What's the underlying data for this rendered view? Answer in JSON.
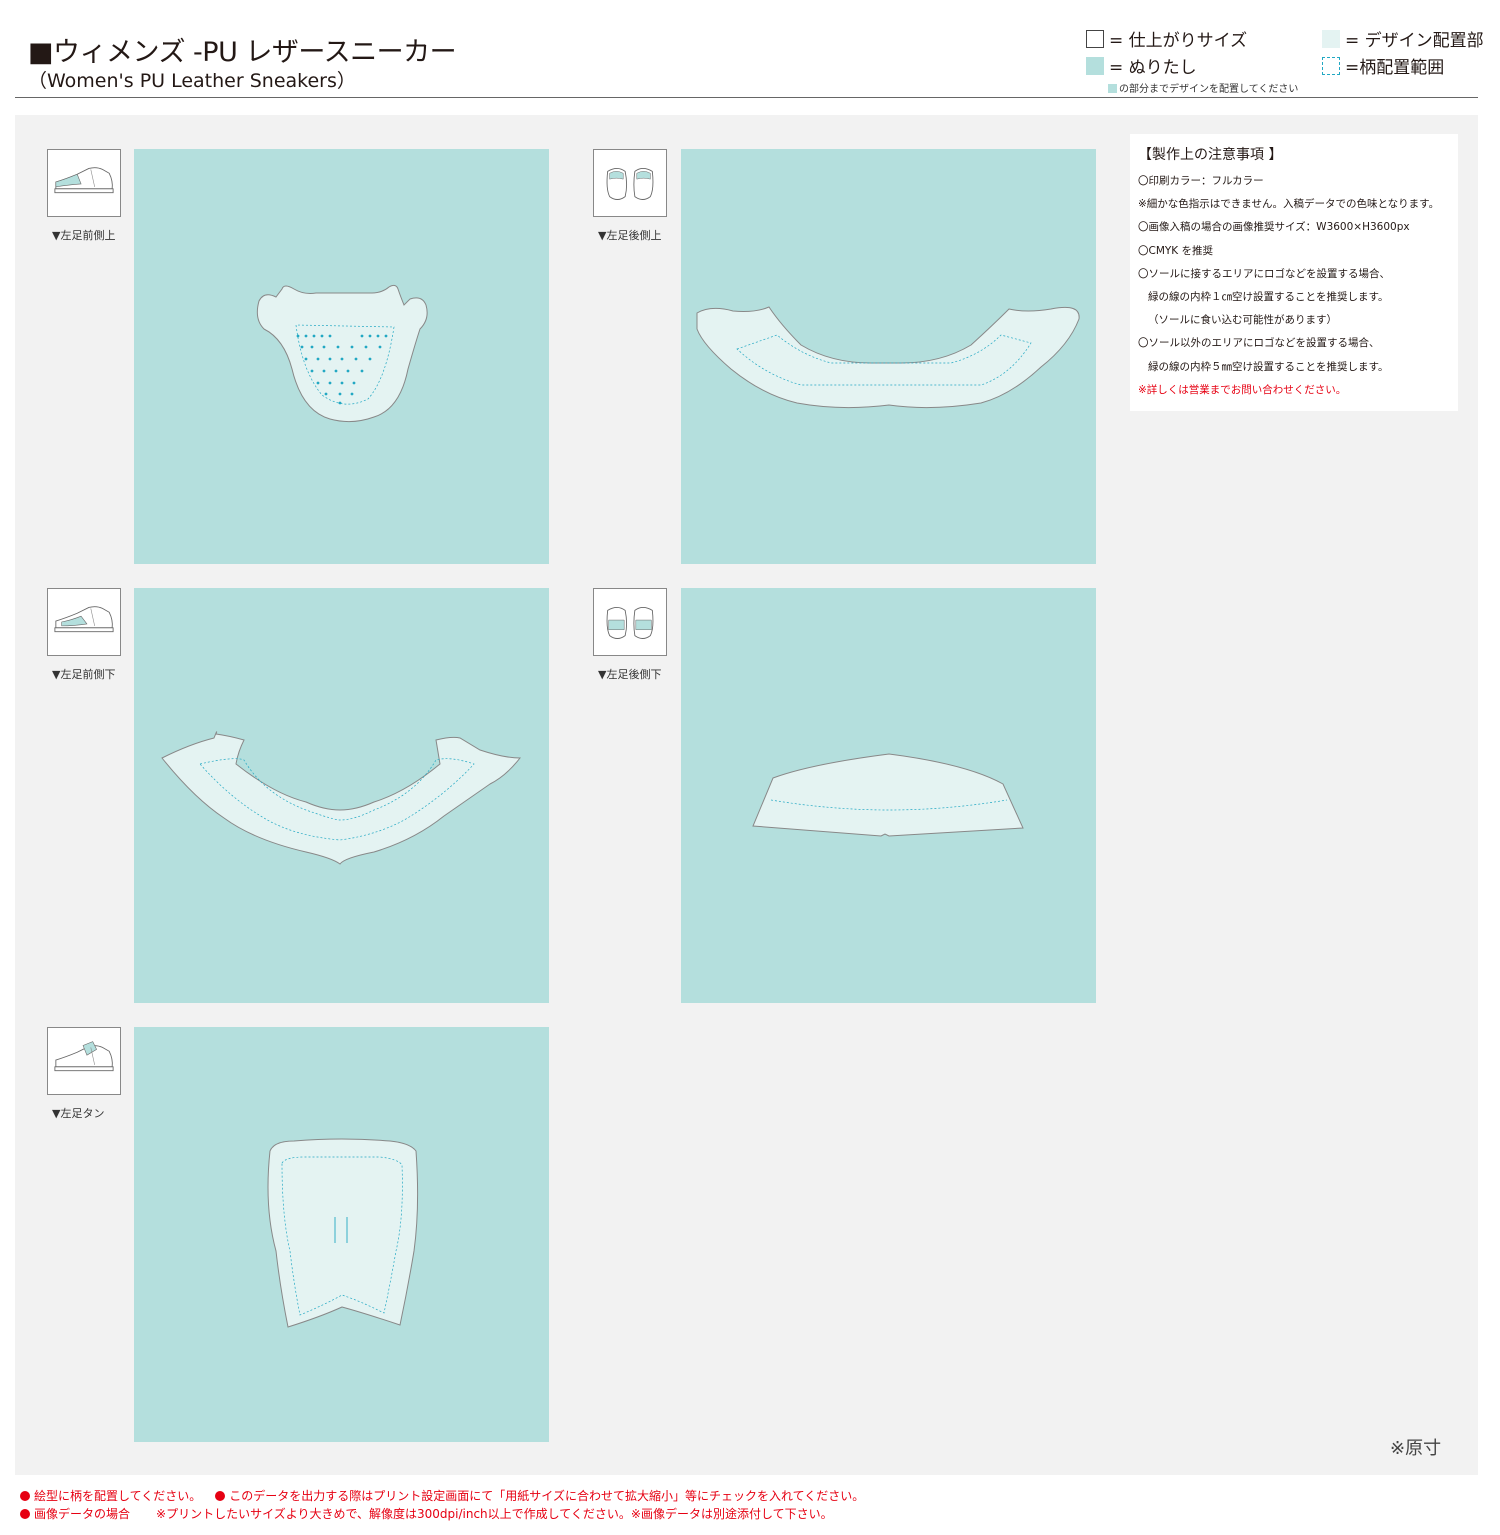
{
  "header": {
    "title": "■ウィメンズ -PU レザースニーカー",
    "subtitle": "（Women's PU Leather Sneakers）"
  },
  "legend": {
    "trim": "= 仕上がりサイズ",
    "bleed": "= ぬりたし",
    "design": "= デザイン配置部",
    "range": "=柄配置範囲",
    "note": "の部分までデザインを配置してください"
  },
  "panels": [
    {
      "label": "▼左足前側上",
      "thumb_icon": "sneaker-side-icon",
      "shape": "toe-cap"
    },
    {
      "label": "▼左足後側上",
      "thumb_icon": "sneaker-back-icon",
      "shape": "heel-collar"
    },
    {
      "label": "▼左足前側下",
      "thumb_icon": "sneaker-side-icon",
      "shape": "front-quarter"
    },
    {
      "label": "▼左足後側下",
      "thumb_icon": "sneaker-back-icon",
      "shape": "heel-counter"
    },
    {
      "label": "▼左足タン",
      "thumb_icon": "sneaker-side-icon",
      "shape": "tongue"
    }
  ],
  "notes": {
    "title": "【製作上の注意事項 】",
    "lines": [
      "〇印刷カラー：フルカラー",
      "※細かな色指示はできません。入稿データでの色味となります。",
      "〇画像入稿の場合の画像推奨サイズ：W3600×H3600px",
      "〇CMYK を推奨",
      "〇ソールに接するエリアにロゴなどを設置する場合、",
      "緑の線の内枠１㎝空け設置することを推奨します。",
      "（ソールに食い込む可能性があります）",
      "〇ソール以外のエリアにロゴなどを設置する場合、",
      "緑の線の内枠５㎜空け設置することを推奨します。",
      "※詳しくは営業までお問い合わせください。"
    ]
  },
  "scale_note": "※原寸",
  "footer": {
    "line1_a": "絵型に柄を配置してください。",
    "line1_b": "このデータを出力する際はプリント設定画面にて「用紙サイズに合わせて拡大縮小」等にチェックを入れてください。",
    "line2_a": "画像データの場合",
    "line2_b": "※プリントしたいサイズより大きめで、解像度は300dpi/inch以上で作成してください。※画像データは別途添付して下さい。"
  },
  "colors": {
    "bleed": "#b4dfdd",
    "design_area": "#e4f3f2",
    "range_line": "#22a8c3",
    "warning": "#e60012"
  }
}
